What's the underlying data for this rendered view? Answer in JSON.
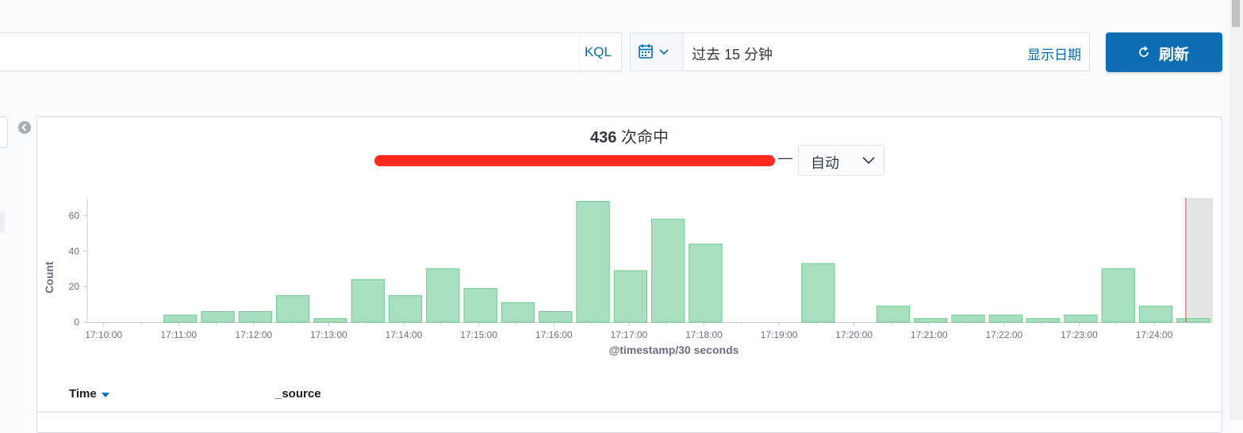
{
  "query_bar": {
    "language_label": "KQL"
  },
  "date_picker": {
    "calendar_icon": "calendar-icon",
    "range_text": "过去 15 分钟",
    "show_dates_label": "显示日期"
  },
  "refresh": {
    "label": "刷新",
    "icon": "refresh-icon"
  },
  "panel": {
    "hits_count": "436",
    "hits_label": "次命中",
    "range_separator": "—",
    "interval_value": "自动"
  },
  "chart_data": {
    "type": "bar",
    "xlabel": "@timestamp/30 seconds",
    "ylabel": "Count",
    "ylim": [
      0,
      70
    ],
    "yticks": [
      0,
      20,
      40,
      60
    ],
    "xtick_labels": [
      "17:10:00",
      "17:11:00",
      "17:12:00",
      "17:13:00",
      "17:14:00",
      "17:15:00",
      "17:16:00",
      "17:17:00",
      "17:18:00",
      "17:19:00",
      "17:20:00",
      "17:21:00",
      "17:22:00",
      "17:23:00",
      "17:24:00"
    ],
    "x": [
      "17:10:00",
      "17:10:30",
      "17:11:00",
      "17:11:30",
      "17:12:00",
      "17:12:30",
      "17:13:00",
      "17:13:30",
      "17:14:00",
      "17:14:30",
      "17:15:00",
      "17:15:30",
      "17:16:00",
      "17:16:30",
      "17:17:00",
      "17:17:30",
      "17:18:00",
      "17:18:30",
      "17:19:00",
      "17:19:30",
      "17:20:00",
      "17:20:30",
      "17:21:00",
      "17:21:30",
      "17:22:00",
      "17:22:30",
      "17:23:00",
      "17:23:30",
      "17:24:00",
      "17:24:30"
    ],
    "values": [
      0,
      0,
      4,
      6,
      6,
      15,
      2,
      24,
      15,
      30,
      19,
      11,
      6,
      68,
      29,
      58,
      44,
      0,
      0,
      33,
      0,
      9,
      2,
      4,
      4,
      2,
      4,
      30,
      9,
      2
    ],
    "bar_color": "#a8dfbe",
    "bar_stroke": "#6ccb8f",
    "now_marker_color": "#e7664c",
    "grid": false
  },
  "table": {
    "time_header": "Time",
    "source_header": "_source"
  }
}
